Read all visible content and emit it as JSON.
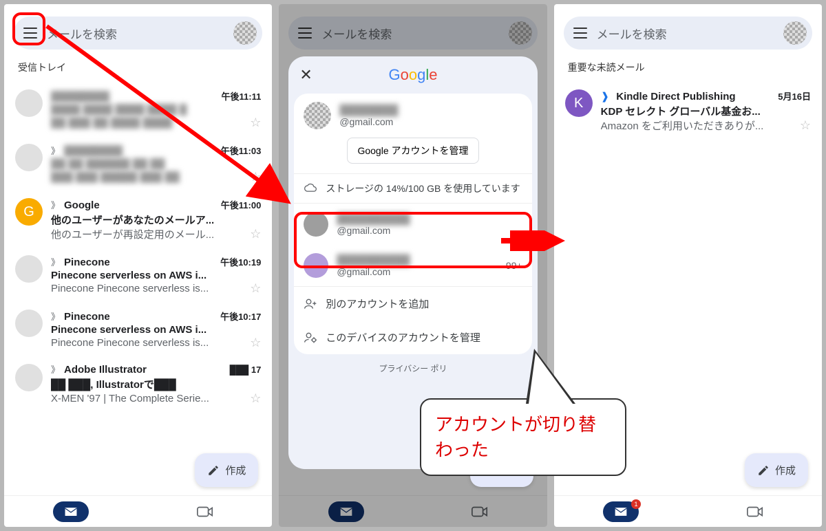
{
  "common": {
    "search_placeholder": "メールを検索",
    "compose": "作成"
  },
  "screen1": {
    "section": "受信トレイ",
    "items": [
      {
        "sender": "████████",
        "time": "午後11:11",
        "subject": "████ ████ ████ ████ █",
        "preview": "██ ███ ██ ████ ████",
        "avatar": "",
        "blur": true
      },
      {
        "sender": "████████",
        "time": "午後11:03",
        "subject": "██ ██ ██████ ██ ██",
        "preview": "███ ███ █████ ███ ██",
        "avatar": "",
        "blur": true,
        "chev": true
      },
      {
        "sender": "Google",
        "time": "午後11:00",
        "subject": "他のユーザーがあなたのメールア...",
        "preview": "他のユーザーが再設定用のメール...",
        "avatar": "G",
        "color": "g",
        "chev": true
      },
      {
        "sender": "Pinecone",
        "time": "午後10:19",
        "subject": "Pinecone serverless on AWS i...",
        "preview": "Pinecone Pinecone serverless is...",
        "avatar": "",
        "chev": true
      },
      {
        "sender": "Pinecone",
        "time": "午後10:17",
        "subject": "Pinecone serverless on AWS i...",
        "preview": "Pinecone Pinecone serverless is...",
        "avatar": "",
        "chev": true
      },
      {
        "sender": "Adobe Illustrator",
        "time": "███ 17",
        "subject": "██ ███, Illustratorで███",
        "preview": "X-MEN '97 | The Complete Serie...",
        "avatar": "",
        "chev": true
      }
    ]
  },
  "modal": {
    "current_email": "@gmail.com",
    "manage": "Google アカウントを管理",
    "storage": "ストレージの 14%/100 GB を使用しています",
    "accounts": [
      {
        "email": "@gmail.com",
        "count": ""
      },
      {
        "email": "@gmail.com",
        "count": "99+"
      }
    ],
    "add": "別のアカウントを追加",
    "manage_device": "このデバイスのアカウントを管理",
    "privacy": "プライバシー ポリ"
  },
  "screen3": {
    "section": "重要な未読メール",
    "item": {
      "sender": "Kindle Direct Publishing",
      "time": "5月16日",
      "subject": "KDP セレクト グローバル基金お...",
      "preview": "Amazon をご利用いただきありが...",
      "avatar": "K"
    },
    "badge": "1"
  },
  "bubble": "アカウントが切り替わった"
}
